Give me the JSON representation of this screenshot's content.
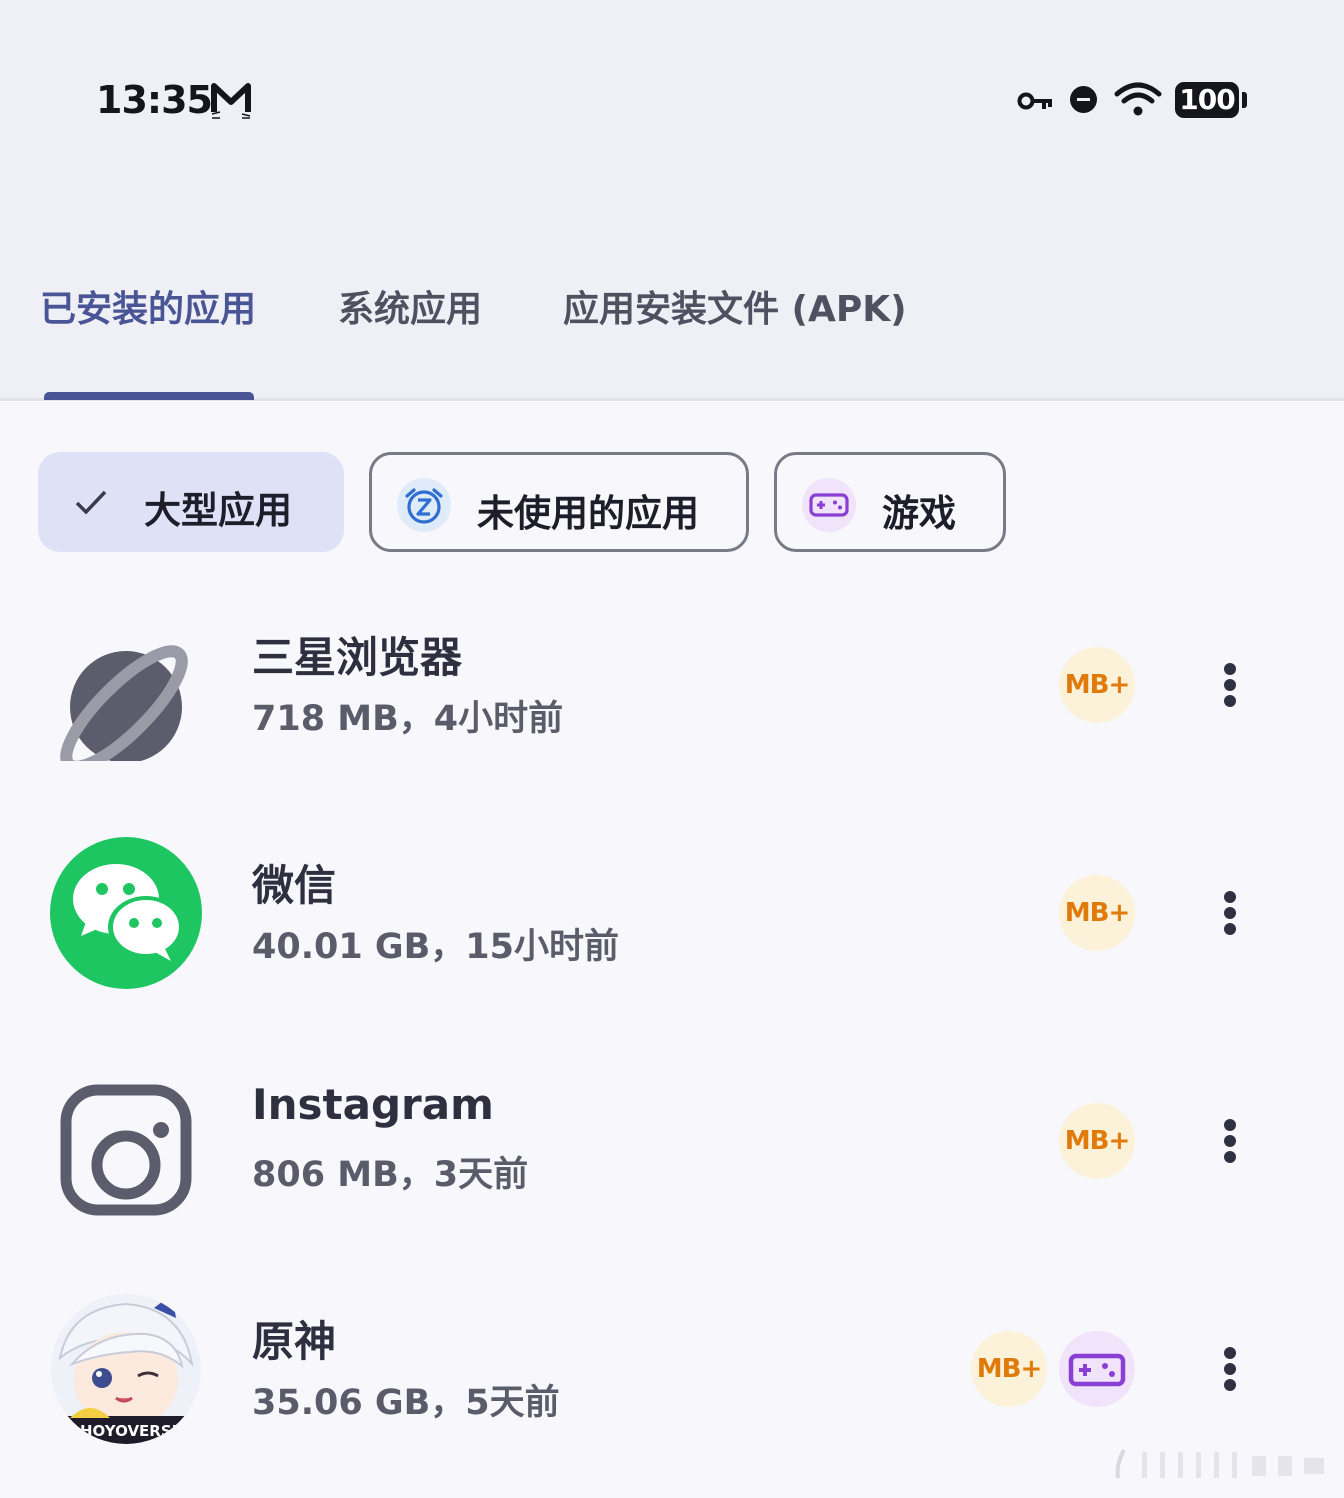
{
  "status_bar": {
    "time": "13:35",
    "battery": "100",
    "icons": [
      "mail-m-icon",
      "vpn-key-icon",
      "do-not-disturb-icon",
      "wifi-icon",
      "battery-icon"
    ]
  },
  "tabs": [
    {
      "label": "已安装的应用",
      "active": true
    },
    {
      "label": "系统应用",
      "active": false
    },
    {
      "label": "应用安装文件 (APK)",
      "active": false
    }
  ],
  "filters": [
    {
      "label": "大型应用",
      "selected": true,
      "icon": "check-icon"
    },
    {
      "label": "未使用的应用",
      "selected": false,
      "icon": "snooze-alarm-icon"
    },
    {
      "label": "游戏",
      "selected": false,
      "icon": "gamepad-icon"
    }
  ],
  "apps": [
    {
      "name": "三星浏览器",
      "meta": "718 MB，4小时前",
      "icon": "samsung-internet-icon",
      "badges": [
        "MB+"
      ]
    },
    {
      "name": "微信",
      "meta": "40.01 GB，15小时前",
      "icon": "wechat-icon",
      "badges": [
        "MB+"
      ]
    },
    {
      "name": "Instagram",
      "meta": "806 MB，3天前",
      "icon": "instagram-icon",
      "badges": [
        "MB+"
      ]
    },
    {
      "name": "原神",
      "meta": "35.06 GB，5天前",
      "icon": "genshin-impact-icon",
      "badges": [
        "MB+",
        "gamepad"
      ]
    }
  ],
  "colors": {
    "accent": "#4a5595",
    "chip_selected_bg": "#dfe1f6",
    "mb_badge_text": "#e07b0b",
    "mb_badge_bg": "#fbf2d9",
    "game_badge_bg": "#f0e3fa",
    "game_purple": "#8a3fd4",
    "wechat_green": "#1ec662"
  }
}
